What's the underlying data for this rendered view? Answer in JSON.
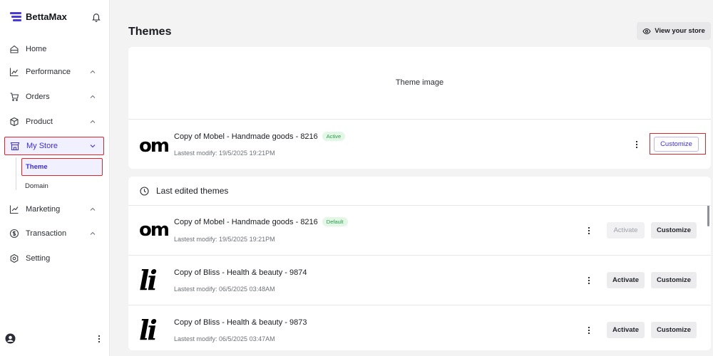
{
  "sidebar": {
    "brand": "BettaMax",
    "items": [
      {
        "label": "Home",
        "icon": "home-icon"
      },
      {
        "label": "Performance",
        "icon": "chart-icon"
      },
      {
        "label": "Orders",
        "icon": "cart-icon"
      },
      {
        "label": "Product",
        "icon": "box-icon"
      },
      {
        "label": "My Store",
        "icon": "store-icon"
      },
      {
        "label": "Marketing",
        "icon": "megaphone-icon"
      },
      {
        "label": "Transaction",
        "icon": "dollar-icon"
      },
      {
        "label": "Setting",
        "icon": "gear-icon"
      }
    ],
    "sub_items": [
      {
        "label": "Theme"
      },
      {
        "label": "Domain"
      }
    ]
  },
  "header": {
    "title": "Themes",
    "view_store": "View your store"
  },
  "current_theme": {
    "image_label": "Theme image",
    "logo_text": "om",
    "name": "Copy of Mobel - Handmade goods - 8216",
    "badge": "Active",
    "modified": "Lastest modify: 19/5/2025 19:21PM",
    "customize": "Customize"
  },
  "last_edited": {
    "title": "Last edited themes",
    "rows": [
      {
        "logo_text": "om",
        "name": "Copy of Mobel - Handmade goods - 8216",
        "badge": "Default",
        "modified": "Lastest modify: 19/5/2025 19:21PM",
        "activate": "Activate",
        "customize": "Customize"
      },
      {
        "logo_text": "li",
        "name": "Copy of Bliss - Health & beauty - 9874",
        "modified": "Lastest modify: 06/5/2025 03:48AM",
        "activate": "Activate",
        "customize": "Customize"
      },
      {
        "logo_text": "li",
        "name": "Copy of Bliss - Health & beauty - 9873",
        "modified": "Lastest modify: 06/5/2025 03:47AM",
        "activate": "Activate",
        "customize": "Customize"
      }
    ]
  },
  "colors": {
    "accent": "#3d2fd0",
    "highlight": "#e0252a",
    "badge_green": "#2d9a48"
  }
}
